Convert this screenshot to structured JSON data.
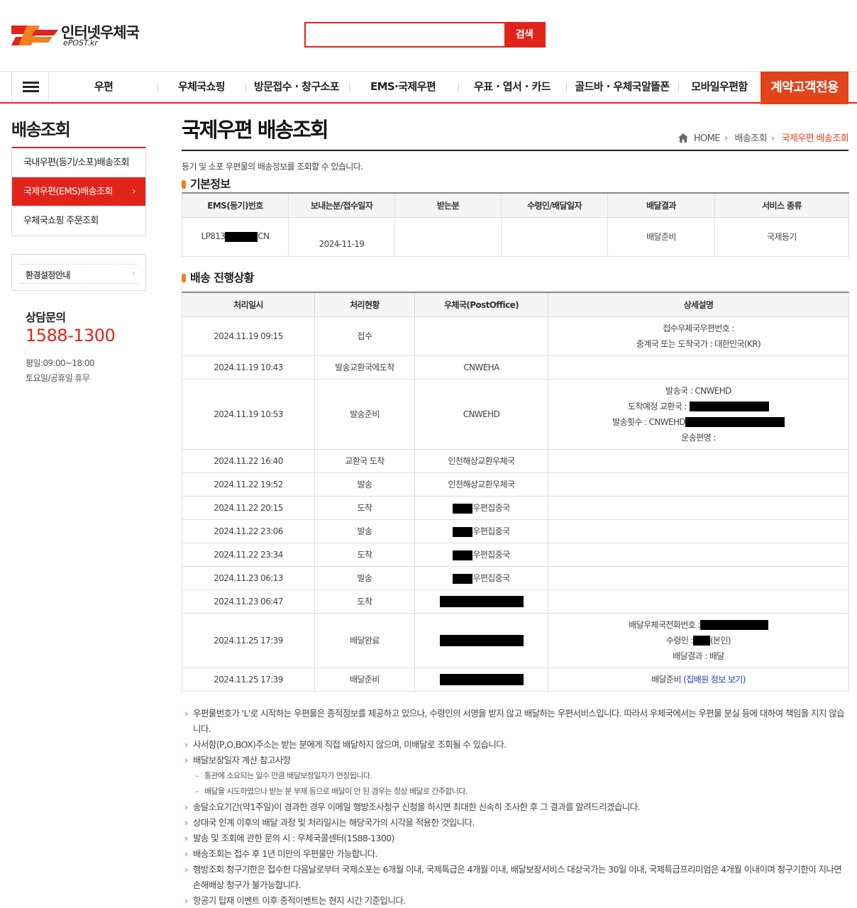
{
  "header": {
    "logo_text": "인터넷우체국",
    "logo_sub": "ePOST.kr",
    "search_placeholder": "",
    "search_button": "검색"
  },
  "nav": {
    "items": [
      "우편",
      "우체국쇼핑",
      "방문접수 · 창구소포",
      "EMS·국제우편",
      "우표 · 엽서 · 카드",
      "골드바 · 우체국알뜰폰",
      "모바일우편함"
    ],
    "special": "계약고객전용"
  },
  "sidebar": {
    "title": "배송조회",
    "items": [
      {
        "label": "국내우편(등기/소포)배송조회"
      },
      {
        "label": "국제우편(EMS)배송조회",
        "arrow": "›"
      },
      {
        "label": "우체국쇼핑 주문조회"
      }
    ],
    "env_label": "환경설정안내",
    "env_arrow": "›",
    "cs_title": "상담문의",
    "cs_phone": "1588-1300",
    "cs_hours_1": "평일:09:00~18:00",
    "cs_hours_2": "토요일/공휴일 휴무"
  },
  "main": {
    "title": "국제우편 배송조회",
    "breadcrumb": {
      "home": "HOME",
      "level1": "배송조회",
      "current": "국제우편 배송조회",
      "sep": "›"
    },
    "intro": "등기 및 소포 우편물의 배송정보를 조회할 수 있습니다.",
    "basic_title": "기본정보",
    "basic_headers": [
      "EMS(등기)번호",
      "보내는분/접수일자",
      "받는분",
      "수령인/배달일자",
      "배달결과",
      "서비스 종류"
    ],
    "basic_row": {
      "ems_prefix": "LP813",
      "ems_suffix": "CN",
      "date": "2024-11-19",
      "result": "배달준비",
      "service": "국제등기"
    },
    "track_title": "배송 진행상황",
    "track_headers": [
      "처리일시",
      "처리현황",
      "우체국(PostOffice)",
      "상세설명"
    ],
    "rows": [
      {
        "time": "2024.11.19 09:15",
        "status": "접수",
        "office": "",
        "details": [
          "접수우체국우편번호 :",
          "중계국 또는 도착국가 : 대한민국(KR)"
        ]
      },
      {
        "time": "2024.11.19 10:43",
        "status": "발송교환국에도착",
        "office": "CNWEHA",
        "details": []
      },
      {
        "time": "2024.11.19 10:53",
        "status": "발송준비",
        "office": "CNWEHD",
        "details": [
          "발송국 : CNWEHD",
          "도착예정 교환국 :",
          "발송횟수 : CNWEHD",
          "운송편명 :"
        ]
      },
      {
        "time": "2024.11.22 16:40",
        "status": "교환국 도착",
        "office": "인천해상교환우체국",
        "details": []
      },
      {
        "time": "2024.11.22 19:52",
        "status": "발송",
        "office": "인천해상교환우체국",
        "details": []
      },
      {
        "time": "2024.11.22 20:15",
        "status": "도착",
        "office": "우편집중국",
        "details": []
      },
      {
        "time": "2024.11.22 23:06",
        "status": "발송",
        "office": "우편집중국",
        "details": []
      },
      {
        "time": "2024.11.22 23:34",
        "status": "도착",
        "office": "우편집중국",
        "details": []
      },
      {
        "time": "2024.11.23 06:13",
        "status": "발송",
        "office": "우편집중국",
        "details": []
      },
      {
        "time": "2024.11.23 06:47",
        "status": "도착",
        "office": "",
        "details": []
      },
      {
        "time": "2024.11.25 17:39",
        "status": "배달완료",
        "office": "",
        "details": [
          "배달우체국전화번호 :",
          "수령인 :",
          "(본인)",
          "배달결과 : 배달"
        ]
      },
      {
        "time": "2024.11.25 17:39",
        "status": "배달준비",
        "office": "",
        "details": [
          "배달준비 ",
          "(집배원 정보 보기)"
        ]
      }
    ],
    "notes": [
      "우편물번호가 'L'로 시작하는 우편물은 종적정보를 제공하고 있으나, 수령인의 서명을 받지 않고 배달하는 우편서비스입니다. 따라서 우체국에서는 우편물 분실 등에 대하여 책임을 지지 않습니다.",
      "사서함(P,O,BOX)주소는 받는 분에게 직접 배달하지 않으며, 미배달로 조회될 수 있습니다.",
      "배달보장일자 계산 참고사항",
      "송달소요기간(약1주일)이 경과한 경우 이메일 행방조사청구 신청을 하시면 최대한 신속히 조사한 후 그 결과를 알려드리겠습니다.",
      "상대국 인계 이후의 배달 과정 및 처리일시는 해당국가의 시각을 적용한 것입니다.",
      "발송 및 조회에 관한 문의 시 : 우체국콜센터(1588-1300)",
      "배송조회는 접수 후 1년 미만의 우편물만 가능합니다.",
      "행방조회 청구기한은 접수한 다음날로부터 국제소포는 6개월 이내, 국제특급은 4개월 이내, 배달보장서비스 대상국가는 30일 이내, 국제특급프리미엄은 4개월 이내이며 청구기한이 지나면 손해배상 청구가 불가능합니다.",
      "항공기 탑재 이벤트 이후 종적이벤트는 현지 시간 기준입니다."
    ],
    "subnotes": [
      "통관에 소요되는 일수 만큼 배달보장일자가 연장됩니다.",
      "배달을 시도하였으나 받는 분 부재 등으로 배달이 안 된 경우는 정상 배달로 간주합니다."
    ]
  }
}
